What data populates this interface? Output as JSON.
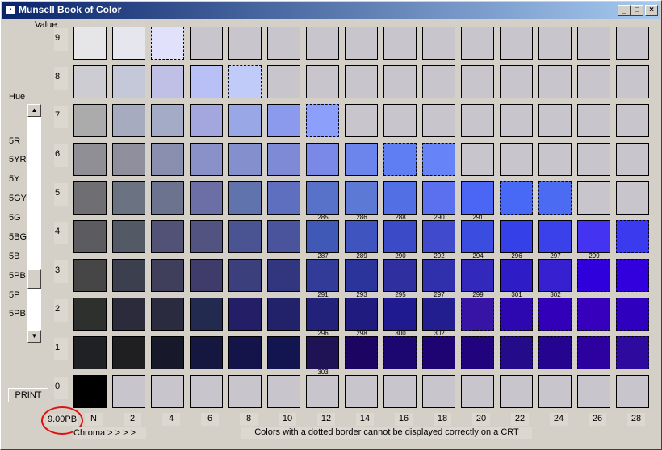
{
  "window": {
    "title": "Munsell Book of Color",
    "buttons": {
      "minimize": "_",
      "maximize": "□",
      "close": "×"
    }
  },
  "labels": {
    "value": "Value",
    "hue": "Hue",
    "chroma": "Chroma > > > >",
    "note": "Colors with a dotted border cannot be displayed correctly on a CRT",
    "current_hue": "9.00PB"
  },
  "value_rows": [
    "9",
    "8",
    "7",
    "6",
    "5",
    "4",
    "3",
    "2",
    "1",
    "0"
  ],
  "chroma_cols": [
    "N",
    "2",
    "4",
    "6",
    "8",
    "10",
    "12",
    "14",
    "16",
    "18",
    "20",
    "22",
    "24",
    "26",
    "28"
  ],
  "hue_list": [
    "5R",
    "5YR",
    "5Y",
    "5GY",
    "5G",
    "5BG",
    "5B",
    "5PB",
    "5P",
    "5PB"
  ],
  "print_button": "PRINT",
  "icons": {
    "app": "window-icon",
    "scroll_up": "up-arrow-icon",
    "scroll_down": "down-arrow-icon"
  },
  "chips": [
    [
      "#e6e6e8",
      "#e6e6ee",
      "#e1e1fb",
      "",
      "",
      "",
      "",
      "",
      "",
      "",
      "",
      "",
      "",
      "",
      ""
    ],
    [
      "#ccccd2",
      "#c4c8d8",
      "#c0c0e6",
      "#b8c0f6",
      "#c0cbfa",
      "",
      "",
      "",
      "",
      "",
      "",
      "",
      "",
      "",
      ""
    ],
    [
      "#ababab",
      "#a7abbf",
      "#a3abc7",
      "#a3a7de",
      "#9aa7e7",
      "#8c9aed",
      "#8c9ffa",
      "",
      "",
      "",
      "",
      "",
      "",
      "",
      ""
    ],
    [
      "#8f8f95",
      "#8f8f9e",
      "#8a8fb0",
      "#8a90c8",
      "#8490ce",
      "#7f8ad6",
      "#7a89e8",
      "#6b85ed",
      "#5f7ef4",
      "#6684f7",
      "",
      "",
      "",
      "",
      ""
    ],
    [
      "#6f6f73",
      "#6b7383",
      "#6b738e",
      "#6b6fa5",
      "#6073ad",
      "#5f6fbf",
      "#5871c9",
      "#5c79d6",
      "#5270e3",
      "#5a70ee",
      "#4b66f4",
      "#4869f5",
      "#4b6bf3",
      "",
      ""
    ],
    [
      "#5b5b60",
      "#535a66",
      "#525276",
      "#525381",
      "#4a5492",
      "#4a549d",
      "#4058b6",
      "#4054c0",
      "#3b4bc8",
      "#3f4bcc",
      "#3a4de0",
      "#3640e8",
      "#3a40ea",
      "#4434f2",
      "#3c3aef"
    ],
    [
      "#464646",
      "#3b3f4e",
      "#3f3f5c",
      "#3f3b6b",
      "#3b3f7b",
      "#32367f",
      "#323c98",
      "#2b349a",
      "#2f2f9f",
      "#3030ac",
      "#3228bb",
      "#2e1cc6",
      "#3720cf",
      "#3000dc",
      "#3100dc"
    ],
    [
      "#2e302e",
      "#2b2b3b",
      "#2b2b40",
      "#222a4f",
      "#231e65",
      "#22226a",
      "#22227a",
      "#1f1b7f",
      "#201a90",
      "#221e90",
      "#3714a6",
      "#2d08b1",
      "#3300b9",
      "#3700bc",
      "#3000bf"
    ],
    [
      "#202124",
      "#1f1f21",
      "#17192a",
      "#151741",
      "#14134a",
      "#121550",
      "#201355",
      "#1c0562",
      "#1c0770",
      "#1d0472",
      "#21047d",
      "#230b8a",
      "#250490",
      "#2d00a0",
      "#2e0a9e"
    ],
    [
      "#000000",
      "",
      "",
      "",
      "",
      "",
      "",
      "",
      "",
      "",
      "",
      "",
      "",
      "",
      ""
    ]
  ],
  "dotted": [
    [
      false,
      false,
      true,
      false,
      false,
      false,
      false,
      false,
      false,
      false,
      false,
      false,
      false,
      false,
      false
    ],
    [
      false,
      false,
      false,
      false,
      true,
      false,
      false,
      false,
      false,
      false,
      false,
      false,
      false,
      false,
      false
    ],
    [
      false,
      false,
      false,
      false,
      false,
      false,
      true,
      false,
      false,
      false,
      false,
      false,
      false,
      false,
      false
    ],
    [
      false,
      false,
      false,
      false,
      false,
      false,
      false,
      false,
      true,
      true,
      false,
      false,
      false,
      false,
      false
    ],
    [
      false,
      false,
      false,
      false,
      false,
      false,
      false,
      false,
      false,
      false,
      false,
      true,
      true,
      false,
      false
    ],
    [
      false,
      false,
      false,
      false,
      false,
      false,
      false,
      false,
      false,
      false,
      false,
      false,
      false,
      false,
      true
    ],
    [
      false,
      false,
      false,
      false,
      false,
      false,
      false,
      false,
      false,
      false,
      false,
      false,
      false,
      true,
      true
    ],
    [
      false,
      false,
      false,
      false,
      false,
      false,
      false,
      false,
      false,
      false,
      true,
      true,
      true,
      true,
      true
    ],
    [
      false,
      false,
      false,
      false,
      false,
      false,
      false,
      true,
      true,
      true,
      true,
      true,
      true,
      true,
      true
    ],
    [
      false,
      false,
      false,
      false,
      false,
      false,
      false,
      false,
      false,
      false,
      false,
      false,
      false,
      false,
      false
    ]
  ],
  "chip_numbers": [
    {
      "row": 4,
      "col": 6,
      "text": "285"
    },
    {
      "row": 4,
      "col": 7,
      "text": "286"
    },
    {
      "row": 4,
      "col": 8,
      "text": "288"
    },
    {
      "row": 4,
      "col": 9,
      "text": "290"
    },
    {
      "row": 4,
      "col": 10,
      "text": "291"
    },
    {
      "row": 5,
      "col": 6,
      "text": "287"
    },
    {
      "row": 5,
      "col": 7,
      "text": "289"
    },
    {
      "row": 5,
      "col": 8,
      "text": "290"
    },
    {
      "row": 5,
      "col": 9,
      "text": "292"
    },
    {
      "row": 5,
      "col": 10,
      "text": "294"
    },
    {
      "row": 5,
      "col": 11,
      "text": "296"
    },
    {
      "row": 5,
      "col": 12,
      "text": "297"
    },
    {
      "row": 5,
      "col": 13,
      "text": "299"
    },
    {
      "row": 6,
      "col": 6,
      "text": "291"
    },
    {
      "row": 6,
      "col": 7,
      "text": "293"
    },
    {
      "row": 6,
      "col": 8,
      "text": "295"
    },
    {
      "row": 6,
      "col": 9,
      "text": "297"
    },
    {
      "row": 6,
      "col": 10,
      "text": "299"
    },
    {
      "row": 6,
      "col": 11,
      "text": "301"
    },
    {
      "row": 6,
      "col": 12,
      "text": "302"
    },
    {
      "row": 7,
      "col": 6,
      "text": "296"
    },
    {
      "row": 7,
      "col": 7,
      "text": "298"
    },
    {
      "row": 7,
      "col": 8,
      "text": "300"
    },
    {
      "row": 7,
      "col": 9,
      "text": "302"
    },
    {
      "row": 8,
      "col": 6,
      "text": "303"
    }
  ],
  "annotation": {
    "color": "#e01010"
  }
}
